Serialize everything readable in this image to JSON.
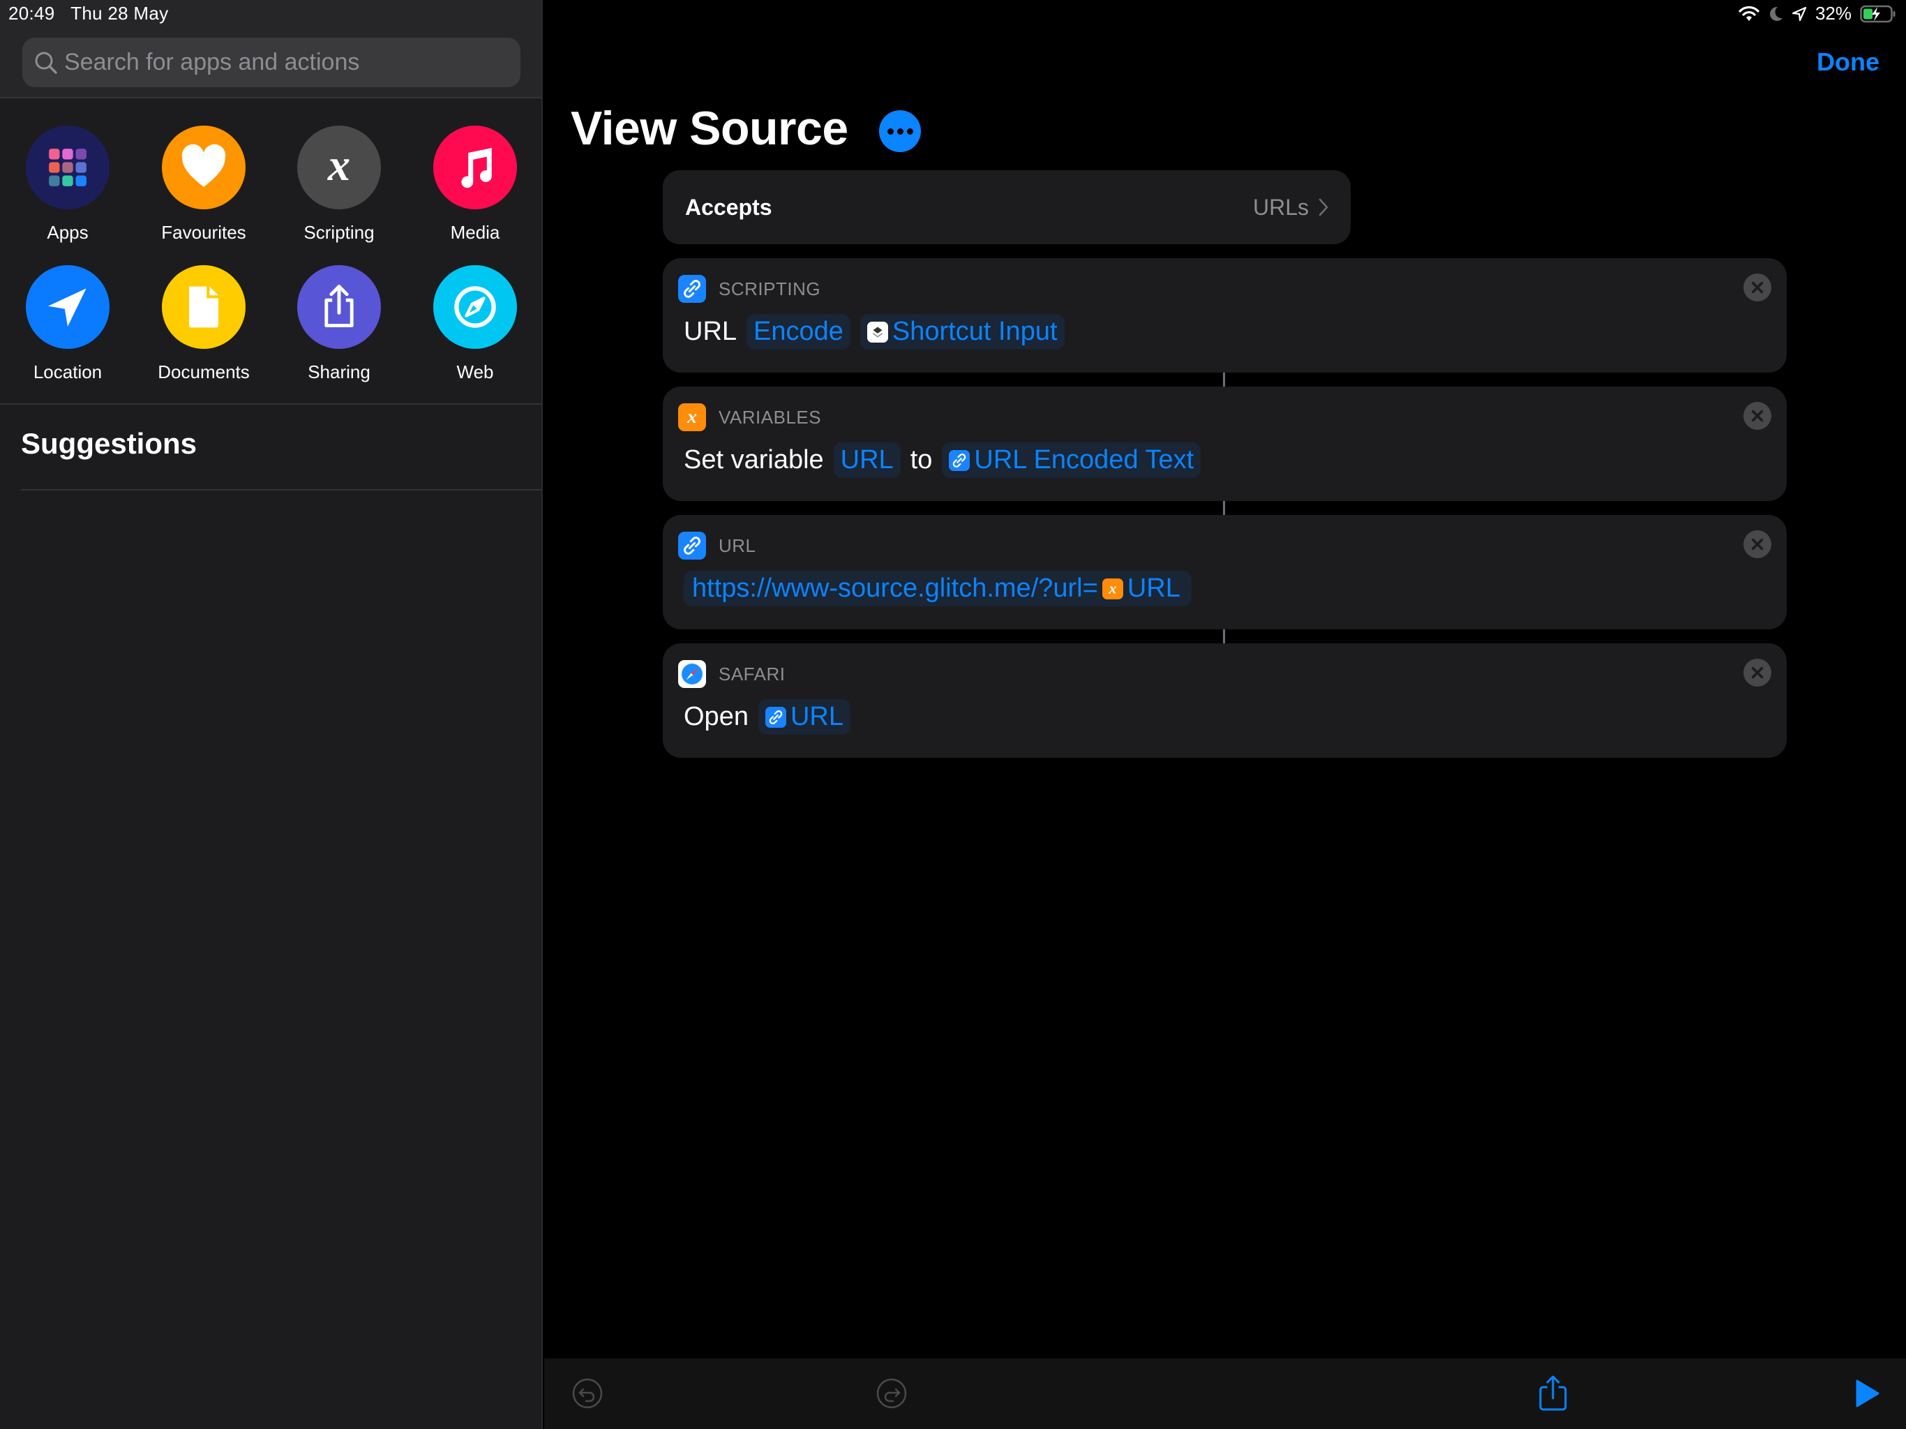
{
  "status_bar": {
    "time": "20:49",
    "date": "Thu 28 May",
    "battery": "32%",
    "icons": [
      "wifi-icon",
      "moon-icon",
      "location-arrow-icon",
      "battery-charging-icon"
    ]
  },
  "sidebar": {
    "search": {
      "placeholder": "Search for apps and actions",
      "value": ""
    },
    "categories": [
      {
        "label": "Apps",
        "icon": "apps-grid-icon",
        "color": "#1c1e5c"
      },
      {
        "label": "Favourites",
        "icon": "heart-icon",
        "color": "#ff9500"
      },
      {
        "label": "Scripting",
        "icon": "variable-x-icon",
        "color": "#4a4a4a"
      },
      {
        "label": "Media",
        "icon": "music-note-icon",
        "color": "#ff0a50"
      },
      {
        "label": "Location",
        "icon": "location-arrow-icon",
        "color": "#0a7aff"
      },
      {
        "label": "Documents",
        "icon": "document-icon",
        "color": "#ffcc00"
      },
      {
        "label": "Sharing",
        "icon": "share-icon",
        "color": "#5856d6"
      },
      {
        "label": "Web",
        "icon": "compass-icon",
        "color": "#00c7f2"
      }
    ],
    "suggestions_title": "Suggestions"
  },
  "header": {
    "done_label": "Done",
    "title": "View Source"
  },
  "accepts": {
    "label": "Accepts",
    "value": "URLs"
  },
  "actions": [
    {
      "category": "SCRIPTING",
      "icon": "link-icon",
      "icon_color": "#1a84ff",
      "parts": [
        {
          "type": "text",
          "text": "URL"
        },
        {
          "type": "token",
          "text": "Encode"
        },
        {
          "type": "token",
          "text": "Shortcut Input",
          "icon": "shortcuts-icon"
        }
      ]
    },
    {
      "category": "VARIABLES",
      "icon": "variable-x-icon",
      "icon_color": "#ff8c0a",
      "parts": [
        {
          "type": "text",
          "text": "Set variable"
        },
        {
          "type": "token",
          "text": "URL"
        },
        {
          "type": "text",
          "text": "to"
        },
        {
          "type": "token",
          "text": "URL Encoded Text",
          "icon": "link-icon"
        }
      ]
    },
    {
      "category": "URL",
      "icon": "link-icon",
      "icon_color": "#1a84ff",
      "parts": [
        {
          "type": "url",
          "text": "https://www-source.glitch.me/?url=",
          "var_text": "URL",
          "var_icon": "variable-x-icon"
        }
      ]
    },
    {
      "category": "SAFARI",
      "icon": "safari-icon",
      "icon_color": "#ffffff",
      "parts": [
        {
          "type": "text",
          "text": "Open"
        },
        {
          "type": "token",
          "text": "URL",
          "icon": "link-icon"
        }
      ]
    }
  ],
  "toolbar": {
    "undo": "undo-icon",
    "redo": "redo-icon",
    "share": "share-icon",
    "run": "play-icon"
  },
  "colors": {
    "accent": "#0a84ff",
    "card": "#1c1c1e",
    "sidebar": "#1c1c1e"
  }
}
